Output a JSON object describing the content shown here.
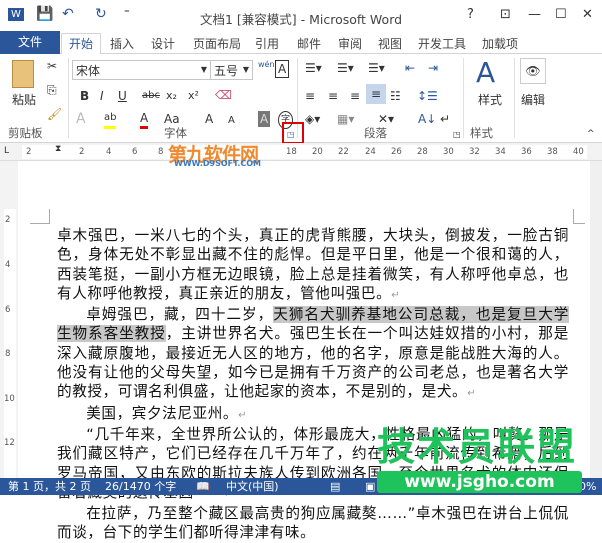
{
  "window": {
    "title": "文档1 [兼容模式] - Microsoft Word",
    "help": "?",
    "restore_ribbon": "⊡",
    "minimize": "—",
    "maximize": "☐",
    "close": "✕"
  },
  "quick_access": {
    "word_icon": "W",
    "save_icon": "💾",
    "undo_icon": "↶",
    "redo_icon": "↻",
    "customize": "⁼"
  },
  "tabs": [
    "文件",
    "开始",
    "插入",
    "设计",
    "页面布局",
    "引用",
    "邮件",
    "审阅",
    "视图",
    "开发工具",
    "加载项"
  ],
  "ribbon": {
    "clipboard": {
      "label": "剪贴板",
      "paste": "粘贴"
    },
    "font": {
      "label": "字体",
      "font_name": "宋体",
      "font_size": "五号",
      "phonetic": "wén",
      "bold": "B",
      "italic": "I",
      "underline": "U",
      "strike": "abc",
      "subscript": "x₂",
      "superscript": "x²",
      "change_case": "Aa",
      "grow": "A",
      "shrink": "A",
      "char_shading": "A",
      "enclose": "字",
      "effects": "A",
      "font_color": "A",
      "highlight": "ab"
    },
    "paragraph": {
      "label": "段落"
    },
    "styles": {
      "label": "样式",
      "button": "样式"
    },
    "editing": {
      "button": "编辑"
    }
  },
  "ruler": {
    "ticks": [
      "2",
      "2",
      "4",
      "6",
      "8",
      "18",
      "20",
      "22",
      "24",
      "26",
      "28",
      "30",
      "32",
      "34",
      "36",
      "38",
      "40"
    ],
    "vticks": [
      "2",
      "4",
      "6",
      "8",
      "10",
      "12"
    ]
  },
  "document": {
    "p1": "卓木强巴，一米八七的个头，真正的虎背熊腰，大块头，倒披发，一脸古铜色，身体无处不彰显出藏不住的彪悍。但是平日里，他是一个很和蔼的人，西装笔挺，一副小方框无边眼镜，脸上总是挂着微笑，有人称呼他卓总，也有人称呼他教授，真正亲近的朋友，管他叫强巴。",
    "p2_a": "卓姆强巴，藏，四十二岁，",
    "p2_highlight": "天狮名犬驯养基地公司总裁，也是复旦大学生物系客坐教授",
    "p2_b": "，主讲世界名犬。强巴生长在一个叫达娃奴措的小村，那是深入藏原腹地，最接近无人区的地方，他的名字，原意是能战胜大海的人。他没有让他的父母失望，如今已是拥有千万资产的公司老总，也是著名大学的教授，可谓名利俱盛，让他起家的资本，不是别的，是犬。",
    "p3": "美国，宾夕法尼亚州。",
    "p4": "“几千年来，全世界所公认的，体形最庞大，性格最凶猛的，叫獒。那是我们藏区特产，它们已经存在几千万年了，约在两千年前流传到希腊，后到罗马帝国，又由东欧的斯拉夫族人传到欧洲各国，至今世界名犬的体内还保留着藏獒的遗传基因——",
    "p5": "在拉萨，乃至整个藏区最高贵的狗应属藏獒……”卓木强巴在讲台上侃侃而谈，台下的学生们都听得津津有味。",
    "para_mark": "↵"
  },
  "status": {
    "page": "第 1 页，共 2 页",
    "words": "26/1470 个字",
    "language": "中文(中国)",
    "zoom": "100%"
  },
  "watermarks": {
    "top": "第九软件网",
    "top_url": "WWW.D9SOFT.COM",
    "bottom": "技术员联盟",
    "bottom_url": "www.jsgho.com"
  },
  "colors": {
    "accent": "#2b579a",
    "highlight": "#c8c8c8",
    "callout": "#e00000"
  }
}
